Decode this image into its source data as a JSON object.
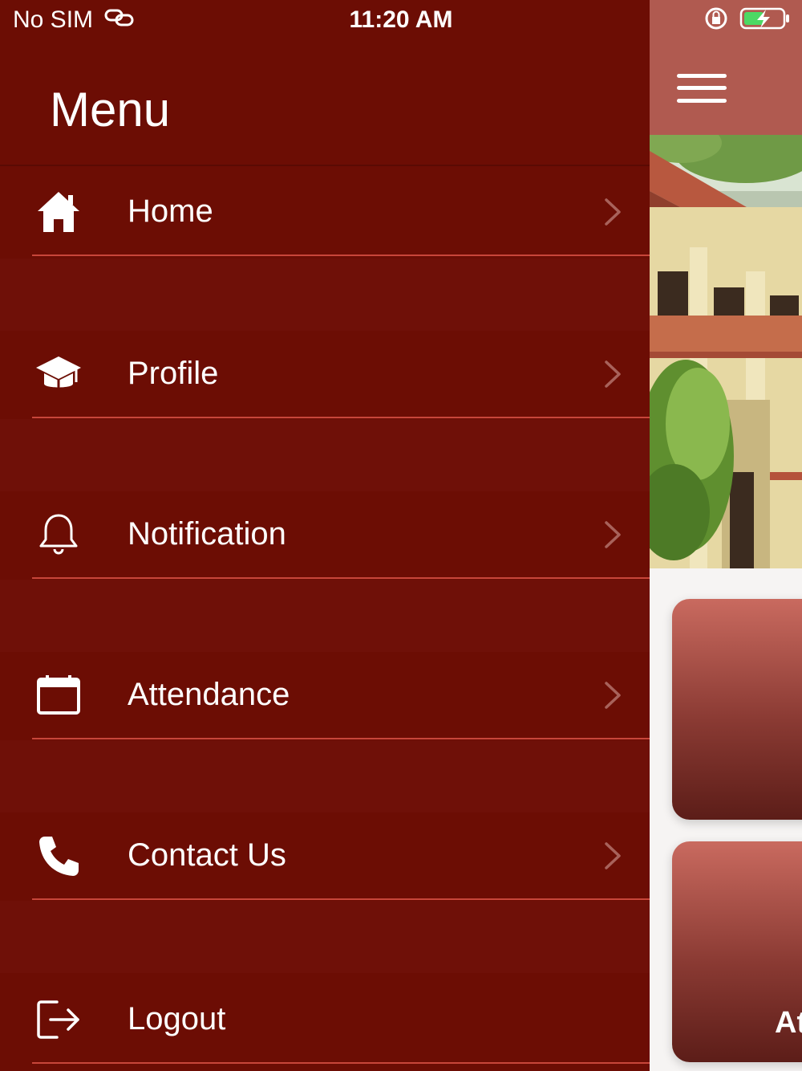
{
  "status_bar": {
    "carrier": "No SIM",
    "time": "11:20 AM",
    "icons": [
      "link-icon",
      "rotation-lock-icon",
      "battery-charging-icon"
    ]
  },
  "drawer": {
    "title": "Menu",
    "items": [
      {
        "label": "Home",
        "icon": "home-icon"
      },
      {
        "label": "Profile",
        "icon": "graduation-cap-icon"
      },
      {
        "label": "Notification",
        "icon": "bell-icon"
      },
      {
        "label": "Attendance",
        "icon": "calendar-icon"
      },
      {
        "label": "Contact Us",
        "icon": "phone-icon"
      },
      {
        "label": "Logout",
        "icon": "logout-icon"
      }
    ]
  },
  "app": {
    "menu_icon": "hamburger-icon",
    "card2_label": "At"
  },
  "colors": {
    "drawer_bg": "#6c0d04",
    "divider": "#c8463a",
    "header": "#b05a50"
  }
}
